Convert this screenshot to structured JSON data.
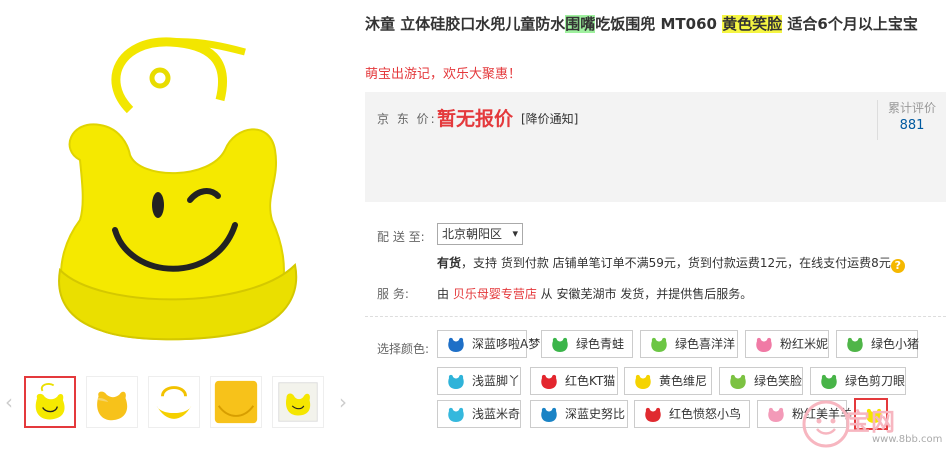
{
  "product": {
    "title_part1": "沐童 立体硅胶口水兜儿童防水",
    "title_hl1": "围嘴",
    "title_part2": "吃饭围兜 MT060 ",
    "title_hl2": "黄色笑脸",
    "title_part3": " 适合6个月以上宝宝",
    "promo": "萌宝出游记，欢乐大聚惠！"
  },
  "price": {
    "label": "京 东 价:",
    "value": "暂无报价",
    "notify": "[降价通知]",
    "review_label": "累计评价",
    "review_count": "881"
  },
  "shipping": {
    "label": "配 送 至:",
    "region": "北京朝阳区",
    "stock_status": "有货",
    "stock_detail": "，支持 货到付款  店铺单笔订单不满59元，货到付款运费12元，在线支付运费8元"
  },
  "service": {
    "label": "服        务:",
    "prefix": "由 ",
    "shop": "贝乐母婴专营店",
    "suffix": " 从 安徽芜湖市 发货，并提供售后服务。"
  },
  "colors": {
    "label": "选择颜色:",
    "items": [
      {
        "label": "深蓝哆啦A梦",
        "color": "#1e6fc7"
      },
      {
        "label": "绿色青蛙",
        "color": "#3bb54a"
      },
      {
        "label": "绿色喜洋洋",
        "color": "#6cc644"
      },
      {
        "label": "粉红米妮",
        "color": "#f07aa5"
      },
      {
        "label": "绿色小猪",
        "color": "#4fb548"
      },
      {
        "label": "浅蓝脚丫",
        "color": "#2fb3d9"
      },
      {
        "label": "红色KT猫",
        "color": "#e3262e"
      },
      {
        "label": "黄色维尼",
        "color": "#f5d300"
      },
      {
        "label": "绿色笑脸",
        "color": "#7cc242"
      },
      {
        "label": "绿色剪刀眼",
        "color": "#48b448"
      },
      {
        "label": "浅蓝米奇",
        "color": "#35b8dd"
      },
      {
        "label": "深蓝史努比",
        "color": "#1a83c5"
      },
      {
        "label": "红色愤怒小鸟",
        "color": "#e02a30"
      },
      {
        "label": "粉红美羊羊",
        "color": "#f39ab8"
      },
      {
        "label": "",
        "color": "#f5e600"
      }
    ]
  },
  "watermark": {
    "text": "宝网",
    "url": "www.8bb.com"
  },
  "icons": {
    "prev": "chevron-left-icon",
    "next": "chevron-right-icon",
    "help": "question-icon"
  },
  "accent": "#e4393c"
}
